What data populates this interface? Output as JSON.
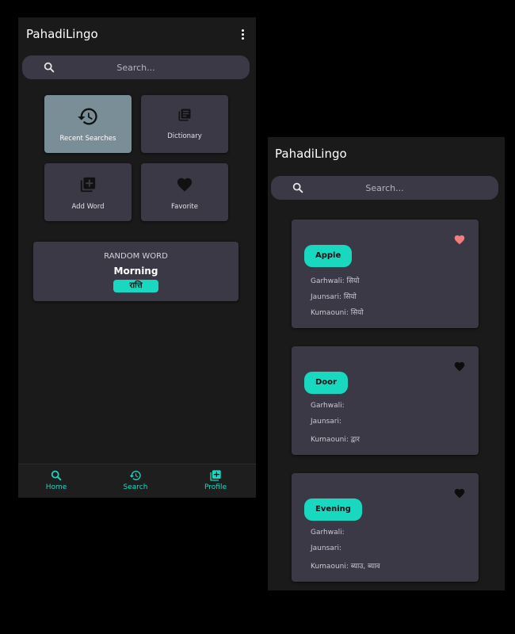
{
  "left_screen": {
    "app_title": "PahadiLingo",
    "search_placeholder": "Search...",
    "tiles": [
      {
        "label": "Recent Searches",
        "icon": "history-icon"
      },
      {
        "label": "Dictionary",
        "icon": "library-books-icon"
      },
      {
        "label": "Add Word",
        "icon": "add-box-icon"
      },
      {
        "label": "Favorite",
        "icon": "heart-icon"
      }
    ],
    "random_word": {
      "title": "RANDOM WORD",
      "word": "Morning",
      "translation": "रात्ति"
    },
    "bottom_nav": [
      {
        "label": "Home",
        "icon": "search-icon"
      },
      {
        "label": "Search",
        "icon": "history-icon"
      },
      {
        "label": "Profile",
        "icon": "add-box-icon"
      }
    ]
  },
  "right_screen": {
    "app_title": "PahadiLingo",
    "search_placeholder": "Search...",
    "words": [
      {
        "word": "Apple",
        "favorited": true,
        "garhwali": "Garhwali: सियो",
        "jaunsari": "Jaunsari: सियो",
        "kumaouni": "Kumaouni: सियो"
      },
      {
        "word": "Door",
        "favorited": false,
        "garhwali": "Garhwali:",
        "jaunsari": "Jaunsari:",
        "kumaouni": "Kumaouni: द्वार"
      },
      {
        "word": "Evening",
        "favorited": false,
        "garhwali": "Garhwali:",
        "jaunsari": "Jaunsari:",
        "kumaouni": "Kumaouni: ब्याउ, ब्याव"
      }
    ]
  },
  "colors": {
    "accent": "#19d8c0",
    "card": "#3a3945",
    "background": "#1a1a1a",
    "heart_active": "#f47c7c",
    "tile_active": "#7a8e98"
  }
}
